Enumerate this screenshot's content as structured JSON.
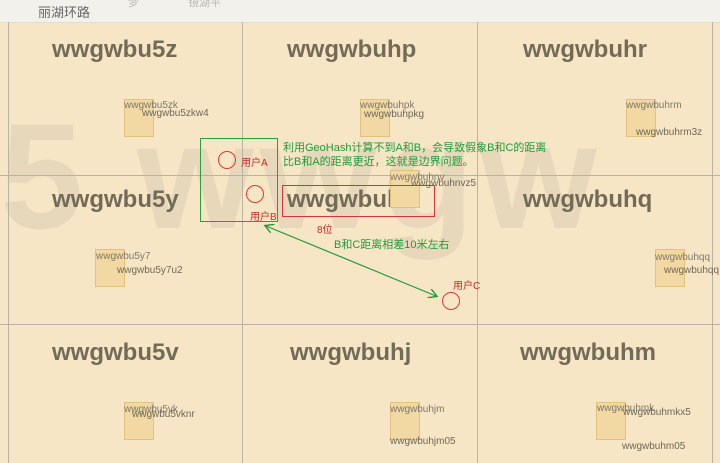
{
  "road_name": "丽湖环路",
  "faded_road_texts": [
    "梦",
    "镜湖平"
  ],
  "watermark_text": "5 wwgw",
  "cells": [
    {
      "id": "u5z",
      "label": "wwgwbu5z",
      "subs": [
        "wwgwbu5zk",
        "wwgwbu5zkw4"
      ]
    },
    {
      "id": "uhp",
      "label": "wwgwbuhp",
      "subs": [
        "wwgwbuhpk",
        "wwgwbuhpkg"
      ]
    },
    {
      "id": "uhr",
      "label": "wwgwbuhr",
      "subs": [
        "wwgwbuhrm",
        "wwgwbuhrm3z"
      ]
    },
    {
      "id": "u5y",
      "label": "wwgwbu5y",
      "subs": [
        "wwgwbu5y7",
        "wwgwbu5y7u2"
      ]
    },
    {
      "id": "uhn",
      "label": "wwgwbuhn",
      "subs": [
        "wwgwbuhnv",
        "wwgwbuhnvz5"
      ]
    },
    {
      "id": "uhq",
      "label": "wwgwbuhq",
      "subs": [
        "wwgwbuhqq",
        "wwgwbuhqq"
      ]
    },
    {
      "id": "u5v",
      "label": "wwgwbu5v",
      "subs": [
        "wwgwbu5vk",
        "wwgwbu5vknr"
      ]
    },
    {
      "id": "uhj",
      "label": "wwgwbuhj",
      "subs": [
        "wwgwbuhjm",
        "wwgwbuhjm05"
      ]
    },
    {
      "id": "uhm",
      "label": "wwgwbuhm",
      "subs": [
        "wwgwbuhmk",
        "wwgwbuhmkx5",
        "wwgwbuhm05"
      ]
    }
  ],
  "annotations": {
    "user_a": "用户A",
    "user_b": "用户B",
    "user_c": "用户C",
    "precision": "8位",
    "note_line1": "利用GeoHash计算不到A和B，会导致假象B和C的距离",
    "note_line2": "比B和A的距离更近，这就是边界问题。",
    "distance_note": "B和C距离相差10米左右"
  },
  "colors": {
    "annotation_green": "#219a3a",
    "annotation_red": "#c52b2b",
    "cell_label": "#736b58"
  }
}
